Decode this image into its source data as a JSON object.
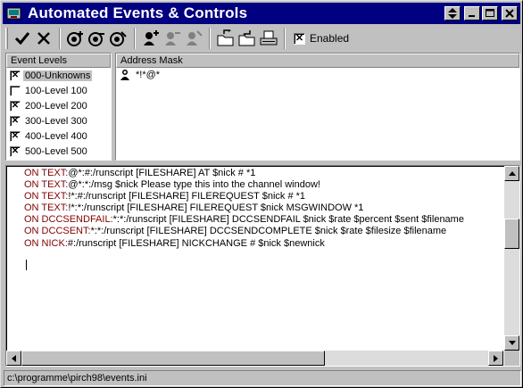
{
  "window": {
    "title": "Automated Events & Controls",
    "icons": [
      "app-icon",
      "restore-icon",
      "minimize-icon",
      "maximize-icon",
      "close-icon"
    ]
  },
  "toolbar": {
    "enabled_label": "Enabled",
    "enabled_checked": true,
    "checkmark": "✕",
    "buttons": [
      "accept-icon",
      "cancel-icon",
      "add-event-icon",
      "remove-event-icon",
      "edit-event-icon",
      "add-user-icon",
      "remove-user-icon",
      "edit-user-icon",
      "open-folder-icon",
      "save-folder-icon",
      "print-icon"
    ]
  },
  "levels": {
    "header": "Event Levels",
    "items": [
      {
        "label": "000-Unknowns",
        "checked": true,
        "selected": true
      },
      {
        "label": "100-Level 100",
        "checked": false,
        "selected": false
      },
      {
        "label": "200-Level 200",
        "checked": true,
        "selected": false
      },
      {
        "label": "300-Level 300",
        "checked": true,
        "selected": false
      },
      {
        "label": "400-Level 400",
        "checked": true,
        "selected": false
      },
      {
        "label": "500-Level 500",
        "checked": true,
        "selected": false
      }
    ]
  },
  "addresses": {
    "header": "Address Mask",
    "items": [
      {
        "mask": "*!*@*",
        "icon": "user-icon"
      }
    ]
  },
  "events": {
    "lines": [
      {
        "prefix": "ON TEXT:",
        "rest": "@*:#:/runscript [FILESHARE] AT $nick # *1"
      },
      {
        "prefix": "ON TEXT:",
        "rest": "@*:*:/msg $nick Please type this into the channel window!"
      },
      {
        "prefix": "ON TEXT:",
        "rest": "!*:#:/runscript [FILESHARE] FILEREQUEST $nick # *1"
      },
      {
        "prefix": "ON TEXT:",
        "rest": "!*:*:/runscript [FILESHARE] FILEREQUEST $nick MSGWINDOW *1"
      },
      {
        "prefix": "ON DCCSENDFAIL:",
        "rest": "*:*:/runscript [FILESHARE] DCCSENDFAIL $nick $rate $percent $sent $filename"
      },
      {
        "prefix": "ON DCCSENT:",
        "rest": "*:*:/runscript [FILESHARE] DCCSENDCOMPLETE $nick $rate $filesize $filename"
      },
      {
        "prefix": "ON NICK:",
        "rest": "#:/runscript [FILESHARE] NICKCHANGE # $nick $newnick"
      }
    ]
  },
  "status": {
    "path": "c:\\programme\\pirch98\\events.ini"
  },
  "colors": {
    "titlebar": "#000080",
    "keyword": "#800000",
    "face": "#c0c0c0"
  }
}
